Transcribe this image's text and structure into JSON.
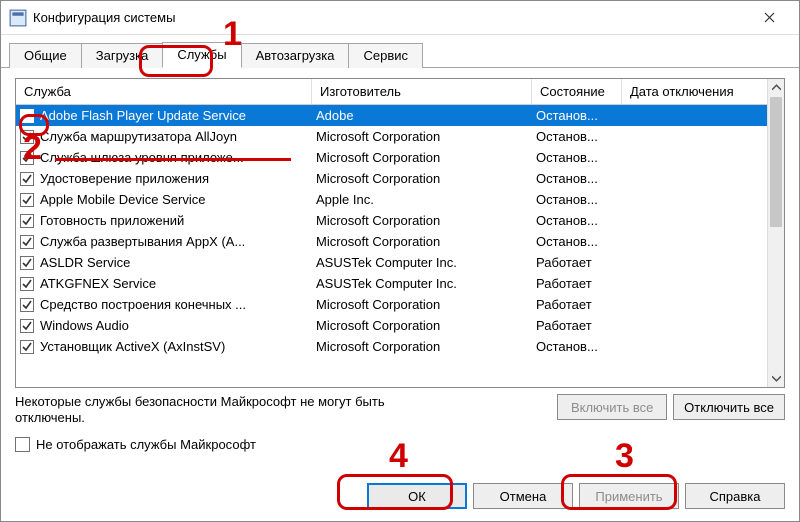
{
  "window": {
    "title": "Конфигурация системы"
  },
  "tabs": {
    "general": "Общие",
    "boot": "Загрузка",
    "services": "Службы",
    "startup": "Автозагрузка",
    "tools": "Сервис"
  },
  "columns": {
    "service": "Служба",
    "manufacturer": "Изготовитель",
    "status": "Состояние",
    "disable_date": "Дата отключения"
  },
  "rows": [
    {
      "name": "Adobe Flash Player Update Service",
      "vendor": "Adobe",
      "status": "Останов..."
    },
    {
      "name": "Служба маршрутизатора AllJoyn",
      "vendor": "Microsoft Corporation",
      "status": "Останов..."
    },
    {
      "name": "Служба шлюза уровня приложе...",
      "vendor": "Microsoft Corporation",
      "status": "Останов..."
    },
    {
      "name": "Удостоверение приложения",
      "vendor": "Microsoft Corporation",
      "status": "Останов..."
    },
    {
      "name": "Apple Mobile Device Service",
      "vendor": "Apple Inc.",
      "status": "Останов..."
    },
    {
      "name": "Готовность приложений",
      "vendor": "Microsoft Corporation",
      "status": "Останов..."
    },
    {
      "name": "Служба развертывания AppX (A...",
      "vendor": "Microsoft Corporation",
      "status": "Останов..."
    },
    {
      "name": "ASLDR Service",
      "vendor": "ASUSTek Computer Inc.",
      "status": "Работает"
    },
    {
      "name": "ATKGFNEX Service",
      "vendor": "ASUSTek Computer Inc.",
      "status": "Работает"
    },
    {
      "name": "Средство построения конечных ...",
      "vendor": "Microsoft Corporation",
      "status": "Работает"
    },
    {
      "name": "Windows Audio",
      "vendor": "Microsoft Corporation",
      "status": "Работает"
    },
    {
      "name": "Установщик ActiveX (AxInstSV)",
      "vendor": "Microsoft Corporation",
      "status": "Останов..."
    }
  ],
  "notes": {
    "line1": "Некоторые службы безопасности Майкрософт не могут быть",
    "line2": "отключены."
  },
  "hide_ms": "Не отображать службы Майкрософт",
  "buttons": {
    "enable_all": "Включить все",
    "disable_all": "Отключить все",
    "ok": "ОК",
    "cancel": "Отмена",
    "apply": "Применить",
    "help": "Справка"
  },
  "annotations": {
    "n1": "1",
    "n2": "2",
    "n3": "3",
    "n4": "4"
  }
}
